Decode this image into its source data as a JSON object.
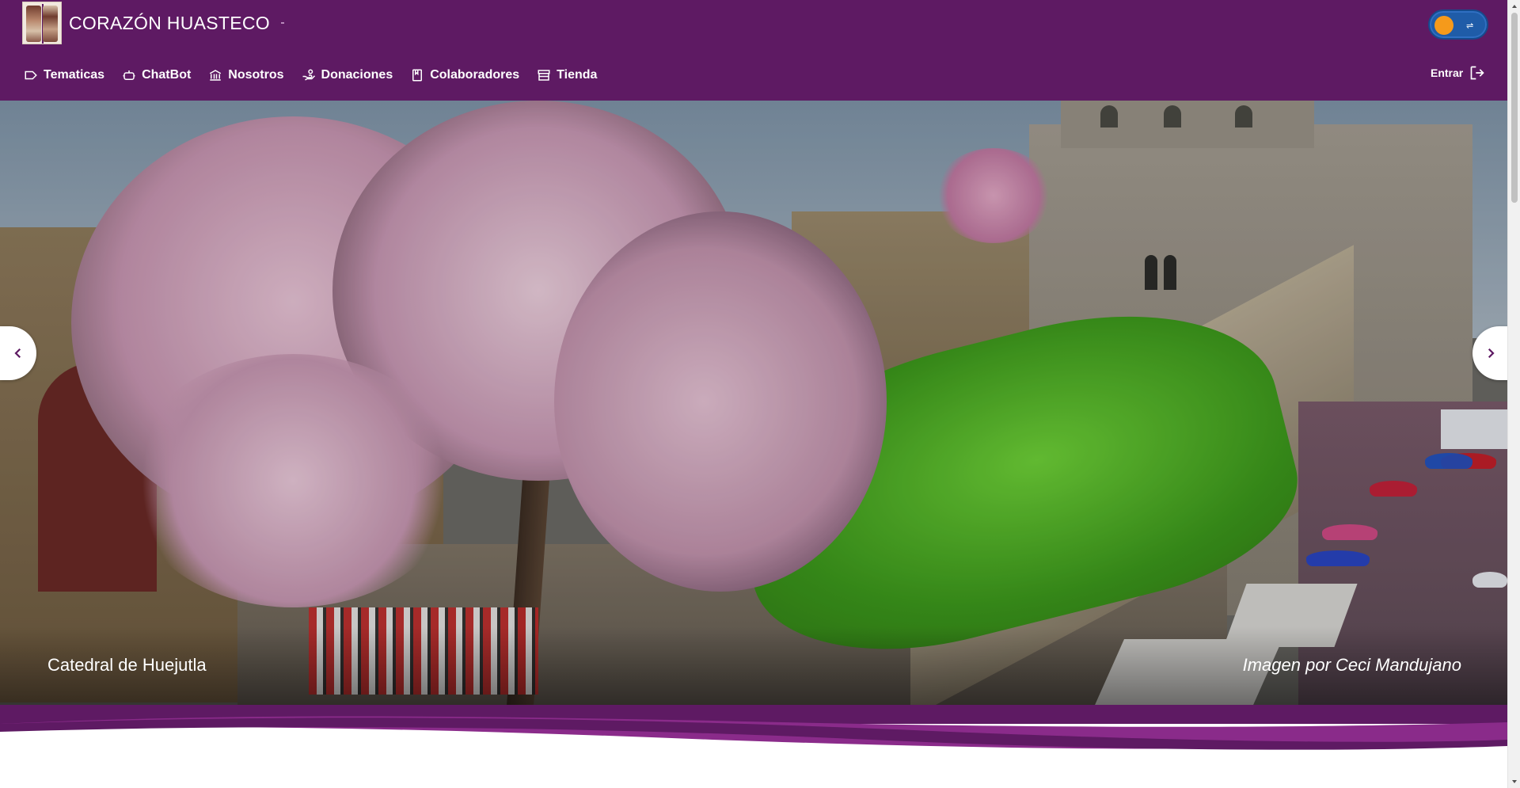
{
  "header": {
    "brand_title": "CORAZÓN HUASTECO",
    "brand_color": "#5e1a63",
    "theme_toggle": {
      "icon": "moon-icon",
      "knob_color": "#f59a1b",
      "track_color": "#1f5ca8"
    },
    "nav": [
      {
        "label": "Tematicas",
        "icon": "tag-icon"
      },
      {
        "label": "ChatBot",
        "icon": "robot-icon"
      },
      {
        "label": "Nosotros",
        "icon": "institution-icon"
      },
      {
        "label": "Donaciones",
        "icon": "donation-hand-icon"
      },
      {
        "label": "Colaboradores",
        "icon": "bookmark-icon"
      },
      {
        "label": "Tienda",
        "icon": "store-icon"
      }
    ],
    "login": {
      "label": "Entrar",
      "icon": "login-icon"
    }
  },
  "hero": {
    "caption_title": "Catedral de Huejutla",
    "caption_credit": "Imagen por Ceci Mandujano",
    "prev_icon": "chevron-left-icon",
    "next_icon": "chevron-right-icon"
  },
  "colors": {
    "wave_dark": "#5e1a63",
    "wave_accent": "#8a2b8a"
  }
}
